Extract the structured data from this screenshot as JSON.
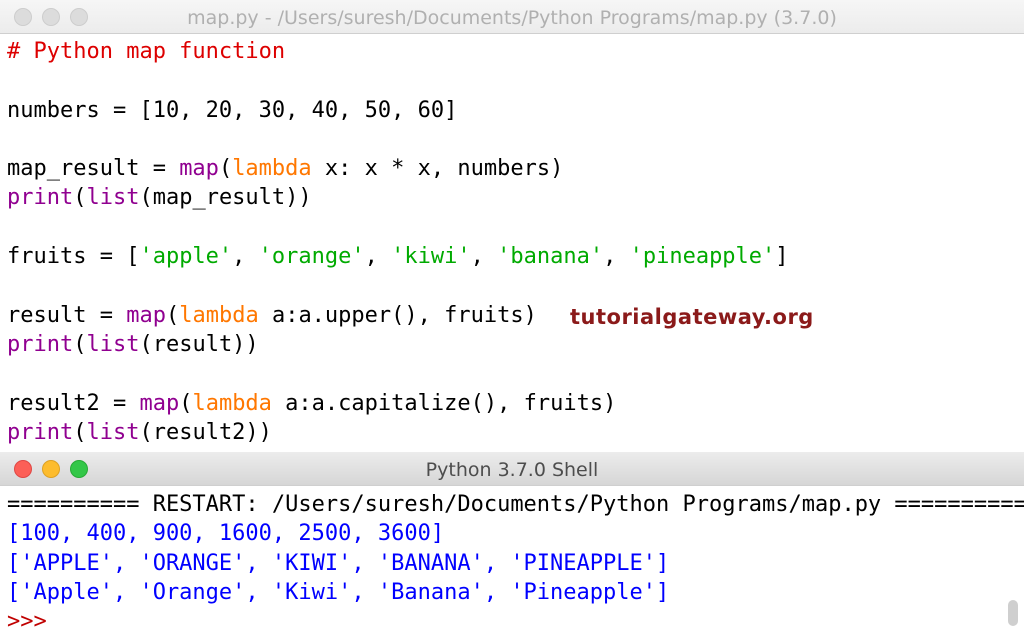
{
  "editor": {
    "title": "map.py - /Users/suresh/Documents/Python Programs/map.py (3.7.0)",
    "lines": {
      "l1": "# Python map function",
      "l3": "numbers = [10, 20, 30, 40, 50, 60]",
      "l5a": "map_result = ",
      "l5b": "map",
      "l5c": "(",
      "l5d": "lambda",
      "l5e": " x: x * x, numbers)",
      "l6a": "print",
      "l6b": "(",
      "l6c": "list",
      "l6d": "(map_result))",
      "l8a": "fruits = [",
      "l8b": "'apple'",
      "l8c": ", ",
      "l8d": "'orange'",
      "l8e": ", ",
      "l8f": "'kiwi'",
      "l8g": ", ",
      "l8h": "'banana'",
      "l8i": ", ",
      "l8j": "'pineapple'",
      "l8k": "]",
      "l10a": "result = ",
      "l10b": "map",
      "l10c": "(",
      "l10d": "lambda",
      "l10e": " a:a.upper(), fruits)",
      "l11a": "print",
      "l11b": "(",
      "l11c": "list",
      "l11d": "(result))",
      "l13a": "result2 = ",
      "l13b": "map",
      "l13c": "(",
      "l13d": "lambda",
      "l13e": " a:a.capitalize(), fruits)",
      "l14a": "print",
      "l14b": "(",
      "l14c": "list",
      "l14d": "(result2))"
    }
  },
  "watermark": "tutorialgateway.org",
  "shell": {
    "title": "Python 3.7.0 Shell",
    "restart": "========== RESTART: /Users/suresh/Documents/Python Programs/map.py ==========",
    "out1": "[100, 400, 900, 1600, 2500, 3600]",
    "out2": "['APPLE', 'ORANGE', 'KIWI', 'BANANA', 'PINEAPPLE']",
    "out3": "['Apple', 'Orange', 'Kiwi', 'Banana', 'Pineapple']",
    "prompt": ">>>"
  },
  "colors": {
    "comment": "#dd0000",
    "keyword": "#ff7700",
    "builtin": "#900090",
    "string": "#00aa00",
    "output": "#0000ff",
    "prompt": "#c00000"
  }
}
